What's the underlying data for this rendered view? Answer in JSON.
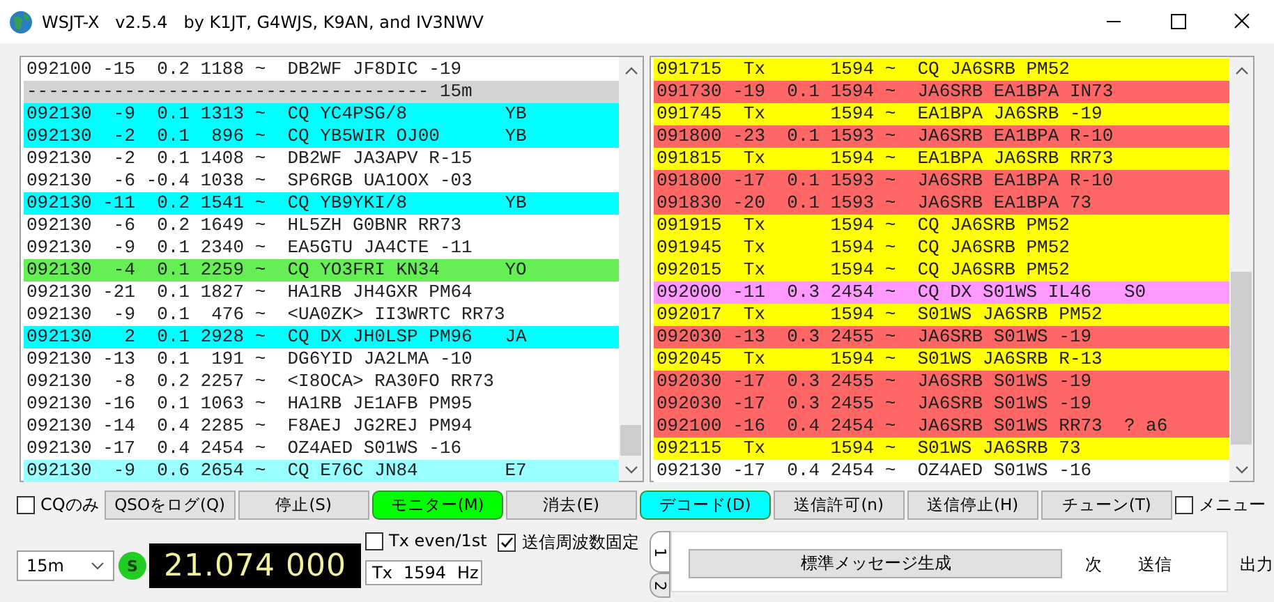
{
  "window": {
    "title": "WSJT-X   v2.5.4   by K1JT, G4WJS, K9AN, and IV3NWV"
  },
  "band_activity": {
    "rows": [
      {
        "color": "#ffffff",
        "text": "092100 -15  0.2 1188 ~  DB2WF JF8DIC -19"
      },
      {
        "color": "#d3d3d3",
        "text": "------------------------------------- 15m"
      },
      {
        "color": "#00ffff",
        "text": "092130  -9  0.1 1313 ~  CQ YC4PSG/8         YB"
      },
      {
        "color": "#00ffff",
        "text": "092130  -2  0.1  896 ~  CQ YB5WIR OJ00      YB"
      },
      {
        "color": "#ffffff",
        "text": "092130  -2  0.1 1408 ~  DB2WF JA3APV R-15"
      },
      {
        "color": "#ffffff",
        "text": "092130  -6 -0.4 1038 ~  SP6RGB UA1OOX -03"
      },
      {
        "color": "#00ffff",
        "text": "092130 -11  0.2 1541 ~  CQ YB9YKI/8         YB"
      },
      {
        "color": "#ffffff",
        "text": "092130  -6  0.2 1649 ~  HL5ZH G0BNR RR73"
      },
      {
        "color": "#ffffff",
        "text": "092130  -9  0.1 2340 ~  EA5GTU JA4CTE -11"
      },
      {
        "color": "#66ee55",
        "text": "092130  -4  0.1 2259 ~  CQ YO3FRI KN34      YO"
      },
      {
        "color": "#ffffff",
        "text": "092130 -21  0.1 1827 ~  HA1RB JH4GXR PM64"
      },
      {
        "color": "#ffffff",
        "text": "092130  -9  0.1  476 ~  <UA0ZK> II3WRTC RR73"
      },
      {
        "color": "#00ffff",
        "text": "092130   2  0.1 2928 ~  CQ DX JH0LSP PM96   JA"
      },
      {
        "color": "#ffffff",
        "text": "092130 -13  0.1  191 ~  DG6YID JA2LMA -10"
      },
      {
        "color": "#ffffff",
        "text": "092130  -8  0.2 2257 ~  <I8OCA> RA30FO RR73"
      },
      {
        "color": "#ffffff",
        "text": "092130 -16  0.1 1063 ~  HA1RB JE1AFB PM95"
      },
      {
        "color": "#ffffff",
        "text": "092130 -14  0.4 2285 ~  F8AEJ JG2REJ PM94"
      },
      {
        "color": "#ffffff",
        "text": "092130 -17  0.4 2454 ~  OZ4AED S01WS -16"
      },
      {
        "color": "#99ffff",
        "text": "092130  -9  0.6 2654 ~  CQ E76C JN84        E7"
      }
    ]
  },
  "rx_frequency": {
    "rows": [
      {
        "color": "#ffff00",
        "text": "091715  Tx      1594 ~  CQ JA6SRB PM52"
      },
      {
        "color": "#ff6666",
        "text": "091730 -19  0.1 1594 ~  JA6SRB EA1BPA IN73"
      },
      {
        "color": "#ffff00",
        "text": "091745  Tx      1594 ~  EA1BPA JA6SRB -19"
      },
      {
        "color": "#ff6666",
        "text": "091800 -23  0.1 1593 ~  JA6SRB EA1BPA R-10"
      },
      {
        "color": "#ffff00",
        "text": "091815  Tx      1594 ~  EA1BPA JA6SRB RR73"
      },
      {
        "color": "#ff6666",
        "text": "091800 -17  0.1 1593 ~  JA6SRB EA1BPA R-10"
      },
      {
        "color": "#ff6666",
        "text": "091830 -20  0.1 1593 ~  JA6SRB EA1BPA 73"
      },
      {
        "color": "#ffff00",
        "text": "091915  Tx      1594 ~  CQ JA6SRB PM52"
      },
      {
        "color": "#ffff00",
        "text": "091945  Tx      1594 ~  CQ JA6SRB PM52"
      },
      {
        "color": "#ffff00",
        "text": "092015  Tx      1594 ~  CQ JA6SRB PM52"
      },
      {
        "color": "#ff99ff",
        "text": "092000 -11  0.3 2454 ~  CQ DX S01WS IL46   S0"
      },
      {
        "color": "#ffff00",
        "text": "092017  Tx      1594 ~  S01WS JA6SRB PM52"
      },
      {
        "color": "#ff6666",
        "text": "092030 -13  0.3 2455 ~  JA6SRB S01WS -19"
      },
      {
        "color": "#ffff00",
        "text": "092045  Tx      1594 ~  S01WS JA6SRB R-13"
      },
      {
        "color": "#ff6666",
        "text": "092030 -17  0.3 2455 ~  JA6SRB S01WS -19"
      },
      {
        "color": "#ff6666",
        "text": "092030 -17  0.3 2455 ~  JA6SRB S01WS -19"
      },
      {
        "color": "#ff6666",
        "text": "092100 -16  0.4 2454 ~  JA6SRB S01WS RR73  ? a6"
      },
      {
        "color": "#ffff00",
        "text": "092115  Tx      1594 ~  S01WS JA6SRB 73"
      },
      {
        "color": "#ffffff",
        "text": "092130 -17  0.4 2454 ~  OZ4AED S01WS -16"
      }
    ]
  },
  "controls": [
    {
      "kind": "checkbox",
      "label": "CQのみ",
      "checked": false
    },
    {
      "kind": "button",
      "label": "QSOをログ(Q)",
      "on": false
    },
    {
      "kind": "button",
      "label": "停止(S)",
      "on": false
    },
    {
      "kind": "button",
      "label": "モニター(M)",
      "on": true,
      "color": "#00ff00"
    },
    {
      "kind": "button",
      "label": "消去(E)",
      "on": false
    },
    {
      "kind": "button",
      "label": "デコード(D)",
      "on": true,
      "color": "#00ffff"
    },
    {
      "kind": "button",
      "label": "送信許可(n)",
      "on": false
    },
    {
      "kind": "button",
      "label": "送信停止(H)",
      "on": false
    },
    {
      "kind": "button",
      "label": "チューン(T)",
      "on": false
    },
    {
      "kind": "checkbox",
      "label": "メニュー",
      "checked": false
    }
  ],
  "band": {
    "value": "15m"
  },
  "status_indicator": {
    "label": "S"
  },
  "frequency": "21.074 000",
  "tx_even": {
    "label": "Tx even/1st",
    "checked": false
  },
  "hold_tx_freq": {
    "label": "送信周波数固定",
    "checked": true
  },
  "tx_offset": {
    "prefix": "Tx",
    "value": "1594",
    "unit": "Hz"
  },
  "message_tabs": {
    "tabs": [
      {
        "label": "1",
        "selected": true
      },
      {
        "label": "2",
        "selected": false
      }
    ],
    "generate_button": "標準メッセージ生成",
    "next_label": "次",
    "send_label": "送信"
  },
  "power_label": "出力"
}
